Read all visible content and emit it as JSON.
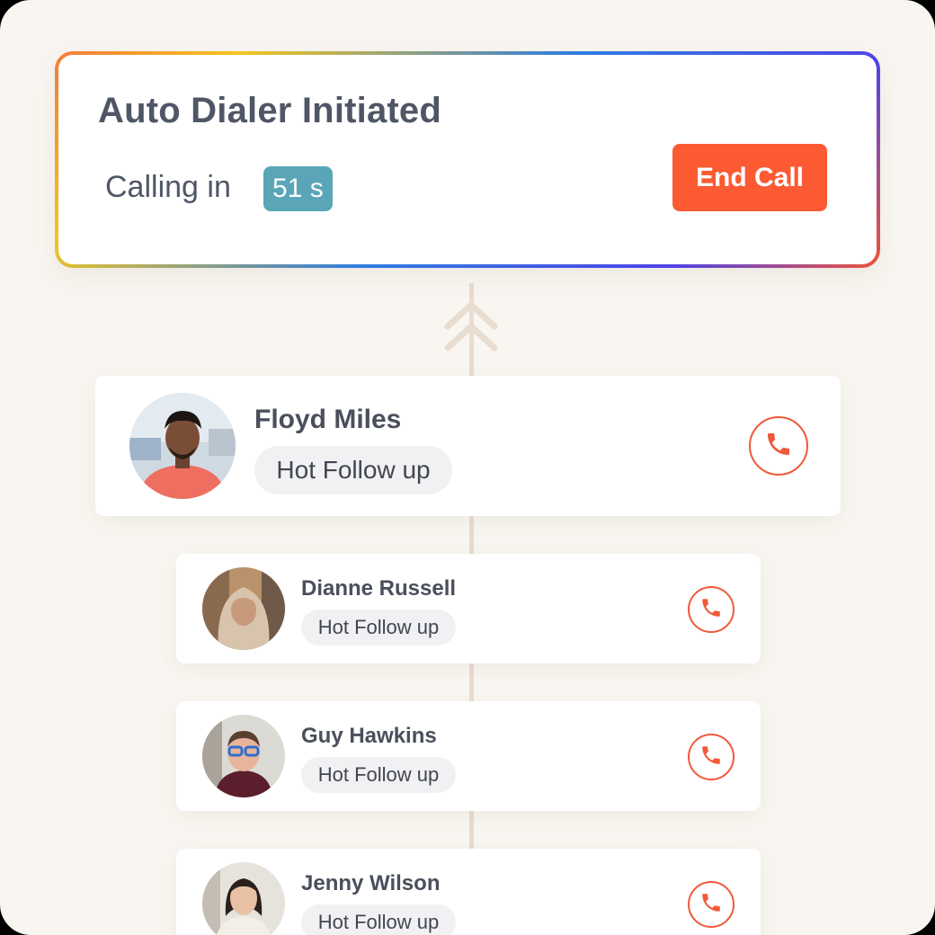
{
  "dialer": {
    "title": "Auto Dialer Initiated",
    "calling_label": "Calling in",
    "countdown": "51 s",
    "end_call_label": "End Call"
  },
  "contacts": [
    {
      "name": "Floyd Miles",
      "tag": "Hot Follow up",
      "avatar_icon": "person-photo"
    },
    {
      "name": "Dianne Russell",
      "tag": "Hot Follow up",
      "avatar_icon": "person-photo"
    },
    {
      "name": "Guy Hawkins",
      "tag": "Hot Follow up",
      "avatar_icon": "person-photo"
    },
    {
      "name": "Jenny Wilson",
      "tag": "Hot Follow up",
      "avatar_icon": "person-photo"
    }
  ],
  "call_icon": "phone-icon",
  "colors": {
    "accent": "#fb5a32",
    "countdown_badge": "#5aa6b8",
    "background": "#f9f6f1",
    "text": "#4f5666"
  }
}
